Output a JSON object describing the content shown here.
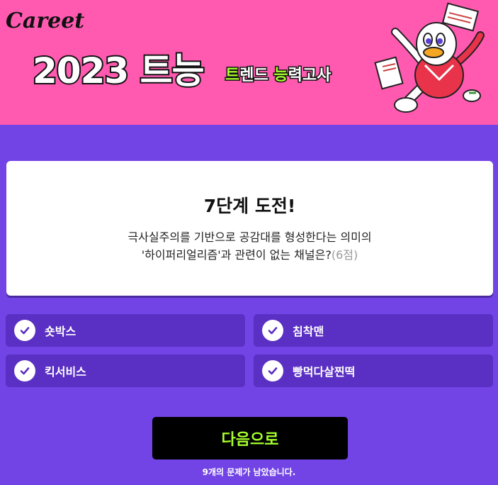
{
  "header": {
    "logo": "Careet",
    "title": "2023 트능",
    "subtitle_part1": "트",
    "subtitle_part2": "렌드 ",
    "subtitle_part3": "능",
    "subtitle_part4": "력고사"
  },
  "quiz": {
    "stage": "7단계 도전!",
    "question_line1": "극사실주의를 기반으로 공감대를 형성한다는 의미의",
    "question_line2": "'하이퍼리얼리즘'과 관련이 없는 채널은?",
    "points": "(6점)"
  },
  "options": [
    {
      "label": "숏박스"
    },
    {
      "label": "침착맨"
    },
    {
      "label": "킥서비스"
    },
    {
      "label": "빵먹다살찐떡"
    }
  ],
  "footer": {
    "next_label": "다음으로",
    "remaining_text": "9개의 문제가 남았습니다."
  },
  "colors": {
    "header_bg": "#ff5ab0",
    "page_bg": "#7244e6",
    "option_bg": "#5a2fc3",
    "accent_green": "#a6ff2c",
    "button_bg": "#000000"
  },
  "icons": {
    "option_check": "check-circle-icon",
    "mascot": "duck-mascot-illustration"
  }
}
